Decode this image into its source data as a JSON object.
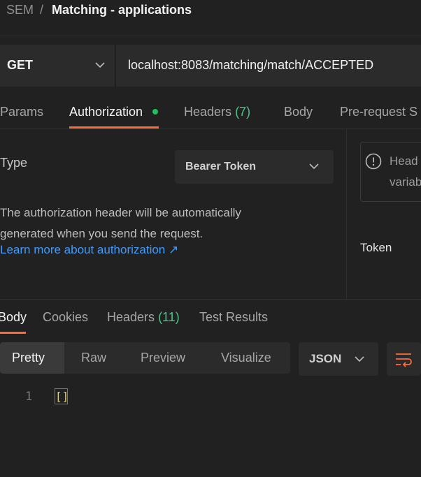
{
  "breadcrumb": {
    "root": "SEM",
    "separator": "/",
    "title": "Matching - applications"
  },
  "request": {
    "method": "GET",
    "url": "localhost:8083/matching/match/ACCEPTED"
  },
  "request_tabs": {
    "params": "Params",
    "authorization": "Authorization",
    "headers": "Headers",
    "headers_count": "(7)",
    "body": "Body",
    "pre_request": "Pre-request S"
  },
  "auth": {
    "type_label": "Type",
    "type_value": "Bearer Token",
    "description": "The authorization header will be automatically generated when you send the request.",
    "learn_more": "Learn more about authorization ↗"
  },
  "info": {
    "line1": "Head",
    "line2": "variab"
  },
  "token_label": "Token",
  "response_tabs": {
    "body": "Body",
    "cookies": "Cookies",
    "headers": "Headers",
    "headers_count": "(11)",
    "test_results": "Test Results"
  },
  "view": {
    "pretty": "Pretty",
    "raw": "Raw",
    "preview": "Preview",
    "visualize": "Visualize",
    "format": "JSON"
  },
  "code": {
    "line_number": "1",
    "content": "[]"
  },
  "colors": {
    "accent": "#ff6c37",
    "link": "#3f9cff",
    "count": "#4dc38a",
    "dot": "#20c05c"
  }
}
